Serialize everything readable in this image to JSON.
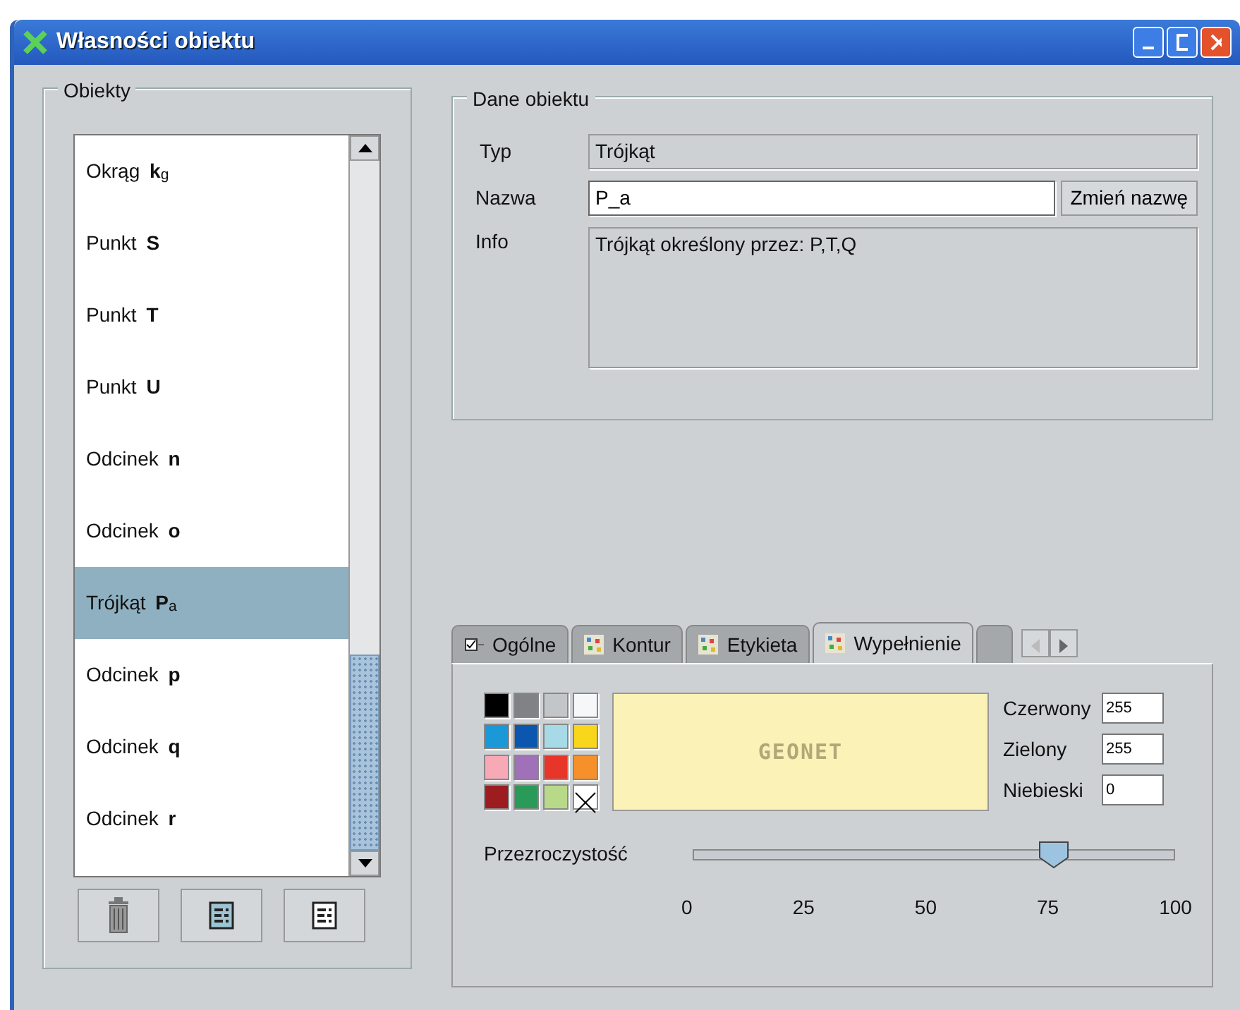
{
  "window": {
    "title": "Własności obiektu"
  },
  "objects": {
    "title": "Obiekty",
    "items": [
      {
        "label": "Okrąg **k**$_{g}$",
        "selected": false
      },
      {
        "label": "Punkt **S**",
        "selected": false
      },
      {
        "label": "Punkt **T**",
        "selected": false
      },
      {
        "label": "Punkt **U**",
        "selected": false
      },
      {
        "label": "Odcinek **n**",
        "selected": false
      },
      {
        "label": "Odcinek **o**",
        "selected": false
      },
      {
        "label": "Trójkąt **P**$_{a}$",
        "selected": true
      },
      {
        "label": "Odcinek **p**",
        "selected": false
      },
      {
        "label": "Odcinek **q**",
        "selected": false
      },
      {
        "label": "Odcinek **r**",
        "selected": false
      }
    ],
    "buttons": [
      {
        "kind": "delete"
      },
      {
        "kind": "list-filled"
      },
      {
        "kind": "list"
      }
    ]
  },
  "details": {
    "title": "Dane obiektu",
    "type": {
      "label": "Typ",
      "value": "Trójkąt"
    },
    "name": {
      "label": "Nazwa",
      "value": "P_a",
      "button": "Zmień nazwę"
    },
    "info": {
      "label": "Info",
      "value": "Trójkąt określony przez: P,T,Q"
    }
  },
  "tabs": [
    {
      "label": "Ogólne",
      "kind": "checkbox",
      "selected": false
    },
    {
      "label": "Kontur",
      "kind": "palette",
      "selected": false
    },
    {
      "label": "Etykieta",
      "kind": "palette",
      "selected": false
    },
    {
      "label": "Wypełnienie",
      "kind": "palette",
      "selected": true
    },
    {
      "kind": "partial",
      "selected": false
    }
  ],
  "fill": {
    "swatches": [
      {
        "color": "#000000"
      },
      {
        "color": "#808285"
      },
      {
        "color": "#c3c6c9"
      },
      {
        "color": "#f6f7f8"
      },
      {
        "color": "#1a98d8"
      },
      {
        "color": "#0b57b0"
      },
      {
        "color": "#a6dae6"
      },
      {
        "color": "#f8d61c"
      },
      {
        "color": "#f7a9b5"
      },
      {
        "color": "#a070b8"
      },
      {
        "color": "#e8352a"
      },
      {
        "color": "#f6902a"
      },
      {
        "color": "#9c1c20"
      },
      {
        "color": "#2a9a58"
      },
      {
        "color": "#b8da88"
      },
      {
        "kind": "none"
      }
    ],
    "preview": {
      "color": "#fbf2b8",
      "logo": "GEONET"
    },
    "channels": [
      {
        "label": "Czerwony",
        "value": "255"
      },
      {
        "label": "Zielony",
        "value": "255"
      },
      {
        "label": "Niebieski",
        "value": "0"
      }
    ],
    "transparency": {
      "label": "Przezroczystość",
      "level": 0.75,
      "ticks": [
        "0",
        "25",
        "50",
        "75",
        "100"
      ]
    }
  }
}
